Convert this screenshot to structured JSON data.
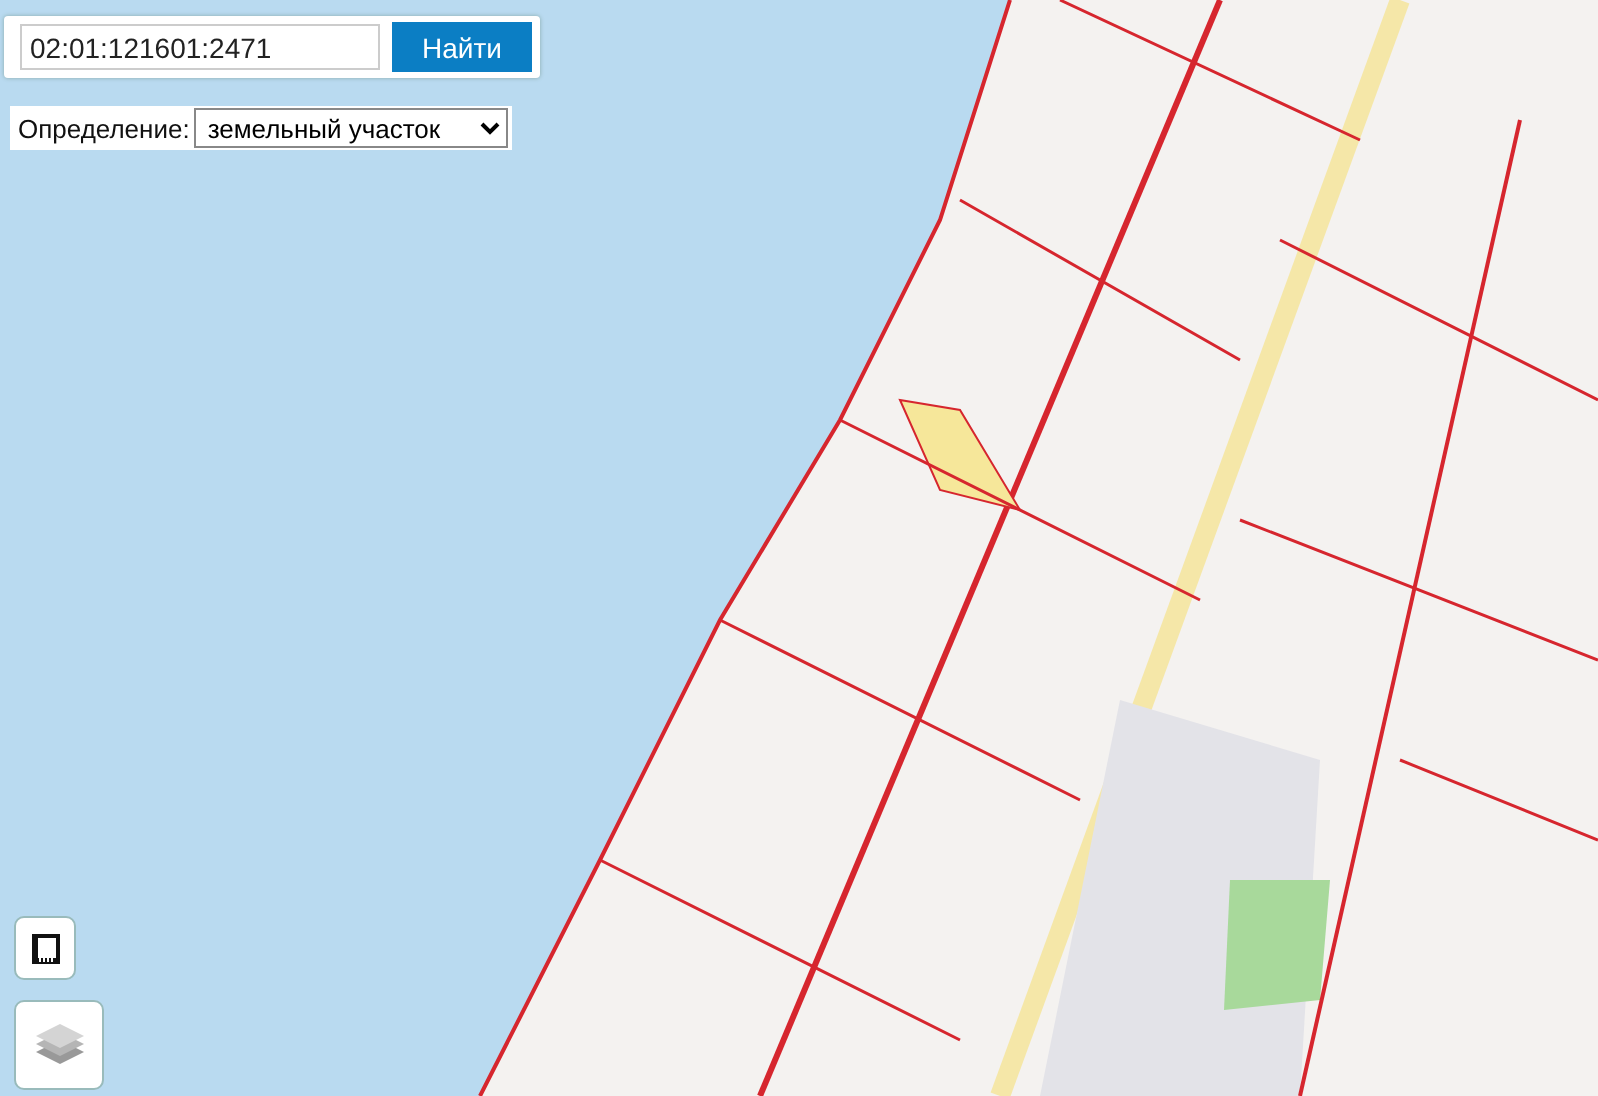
{
  "search": {
    "value": "02:01:121601:2471",
    "button": "Найти"
  },
  "definition": {
    "label": "Определение:",
    "value": "земельный участок"
  }
}
